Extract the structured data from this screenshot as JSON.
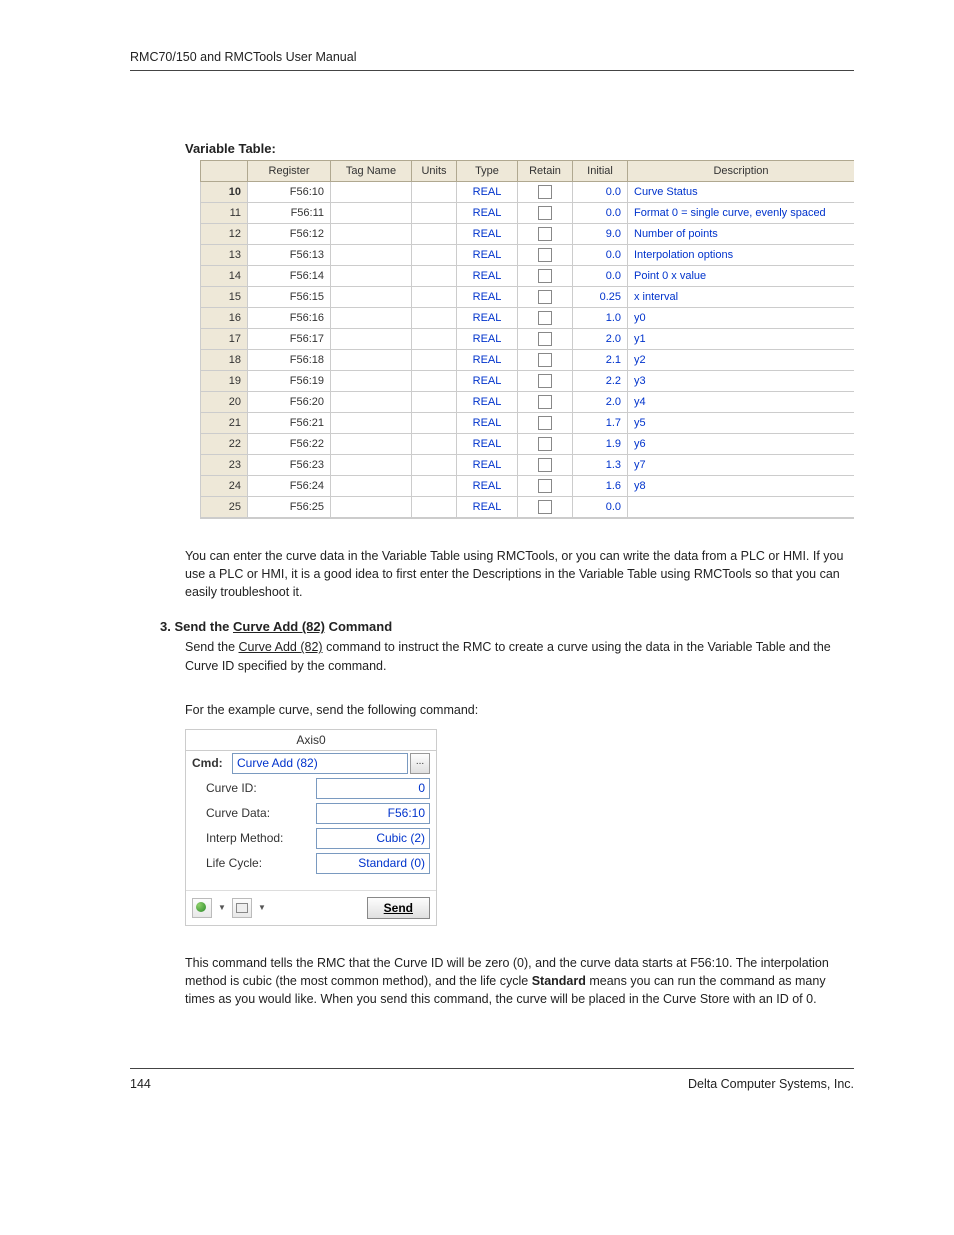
{
  "header": "RMC70/150 and RMCTools User Manual",
  "section_title": "Variable Table:",
  "table": {
    "headers": [
      "",
      "Register",
      "Tag Name",
      "Units",
      "Type",
      "Retain",
      "Initial",
      "Description"
    ],
    "rows": [
      {
        "idx": "10",
        "bold": true,
        "reg": "F56:10",
        "type": "REAL",
        "initial": "0.0",
        "desc": "Curve Status"
      },
      {
        "idx": "11",
        "bold": false,
        "reg": "F56:11",
        "type": "REAL",
        "initial": "0.0",
        "desc": "Format 0 = single curve, evenly spaced"
      },
      {
        "idx": "12",
        "bold": false,
        "reg": "F56:12",
        "type": "REAL",
        "initial": "9.0",
        "desc": "Number of points"
      },
      {
        "idx": "13",
        "bold": false,
        "reg": "F56:13",
        "type": "REAL",
        "initial": "0.0",
        "desc": "Interpolation options"
      },
      {
        "idx": "14",
        "bold": false,
        "reg": "F56:14",
        "type": "REAL",
        "initial": "0.0",
        "desc": "Point 0 x value"
      },
      {
        "idx": "15",
        "bold": false,
        "reg": "F56:15",
        "type": "REAL",
        "initial": "0.25",
        "desc": "x interval"
      },
      {
        "idx": "16",
        "bold": false,
        "reg": "F56:16",
        "type": "REAL",
        "initial": "1.0",
        "desc": "y0"
      },
      {
        "idx": "17",
        "bold": false,
        "reg": "F56:17",
        "type": "REAL",
        "initial": "2.0",
        "desc": "y1"
      },
      {
        "idx": "18",
        "bold": false,
        "reg": "F56:18",
        "type": "REAL",
        "initial": "2.1",
        "desc": "y2"
      },
      {
        "idx": "19",
        "bold": false,
        "reg": "F56:19",
        "type": "REAL",
        "initial": "2.2",
        "desc": "y3"
      },
      {
        "idx": "20",
        "bold": false,
        "reg": "F56:20",
        "type": "REAL",
        "initial": "2.0",
        "desc": "y4"
      },
      {
        "idx": "21",
        "bold": false,
        "reg": "F56:21",
        "type": "REAL",
        "initial": "1.7",
        "desc": "y5"
      },
      {
        "idx": "22",
        "bold": false,
        "reg": "F56:22",
        "type": "REAL",
        "initial": "1.9",
        "desc": "y6"
      },
      {
        "idx": "23",
        "bold": false,
        "reg": "F56:23",
        "type": "REAL",
        "initial": "1.3",
        "desc": "y7"
      },
      {
        "idx": "24",
        "bold": false,
        "reg": "F56:24",
        "type": "REAL",
        "initial": "1.6",
        "desc": "y8"
      },
      {
        "idx": "25",
        "bold": false,
        "reg": "F56:25",
        "type": "REAL",
        "initial": "0.0",
        "desc": ""
      }
    ]
  },
  "para1": "You can enter the curve data in the Variable Table using RMCTools, or you can write the data from a PLC or HMI. If you use a PLC or HMI, it is a good idea to first enter the Descriptions in the Variable Table using RMCTools so that you can easily troubleshoot it.",
  "step": {
    "num": "3.",
    "prefix": "Send the ",
    "link": "Curve Add (82)",
    "suffix": " Command"
  },
  "para2a": "Send the ",
  "para2_link": "Curve Add (82)",
  "para2b": " command to instruct the RMC to create a curve using the data in the Variable Table and the Curve ID specified by the command.",
  "para3": "For the example curve, send the following command:",
  "cmd": {
    "axis": "Axis0",
    "cmd_label": "Cmd:",
    "cmd_value": "Curve Add (82)",
    "more": "...",
    "rows": [
      {
        "label": "Curve ID:",
        "value": "0"
      },
      {
        "label": "Curve Data:",
        "value": "F56:10"
      },
      {
        "label": "Interp Method:",
        "value": "Cubic (2)"
      },
      {
        "label": "Life Cycle:",
        "value": "Standard (0)"
      }
    ],
    "send": "Send"
  },
  "para4_a": "This command tells the RMC that the Curve ID will be zero (0), and the curve data starts at F56:10. The interpolation method is cubic (the most common method), and the life cycle ",
  "para4_b": "Standard",
  "para4_c": " means you can run the command as many times as you would like. When you send this command, the curve will be placed in the Curve Store with an ID of 0.",
  "footer": {
    "page": "144",
    "company": "Delta Computer Systems, Inc."
  }
}
